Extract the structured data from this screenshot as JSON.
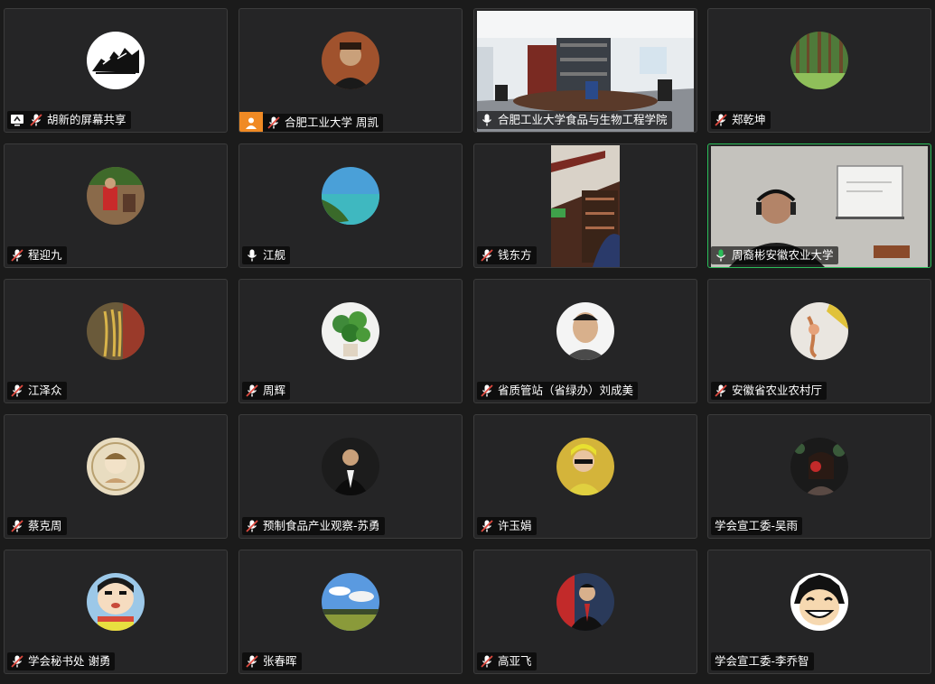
{
  "colors": {
    "background": "#1b1b1b",
    "tile": "#252526",
    "tile_border": "#3c3c3c",
    "active_speaker": "#2bbd59",
    "muted_icon": "#e04a3f",
    "share_icon_bg": "#f08a24"
  },
  "participants": [
    {
      "name": "胡新的屏幕共享",
      "status": "screen-share-muted"
    },
    {
      "name": "合肥工业大学 周凯",
      "status": "muted"
    },
    {
      "name": "合肥工业大学食品与生物工程学院",
      "status": "unmuted"
    },
    {
      "name": "郑乾坤",
      "status": "muted"
    },
    {
      "name": "程迎九",
      "status": "muted"
    },
    {
      "name": "江舰",
      "status": "unmuted"
    },
    {
      "name": "钱东方",
      "status": "muted"
    },
    {
      "name": "周裔彬安徽农业大学",
      "status": "speaking"
    },
    {
      "name": "江泽众",
      "status": "muted"
    },
    {
      "name": "周辉",
      "status": "muted"
    },
    {
      "name": "省质管站（省绿办）刘成美",
      "status": "muted"
    },
    {
      "name": "安徽省农业农村厅",
      "status": "muted"
    },
    {
      "name": "蔡克周",
      "status": "muted"
    },
    {
      "name": "预制食品产业观察-苏勇",
      "status": "muted"
    },
    {
      "name": "许玉娟",
      "status": "muted"
    },
    {
      "name": "学会宣工委-吴雨",
      "status": "none"
    },
    {
      "name": "学会秘书处 谢勇",
      "status": "muted"
    },
    {
      "name": "张春晖",
      "status": "muted"
    },
    {
      "name": "高亚飞",
      "status": "muted"
    },
    {
      "name": "学会宣工委-李乔智",
      "status": "none"
    }
  ]
}
